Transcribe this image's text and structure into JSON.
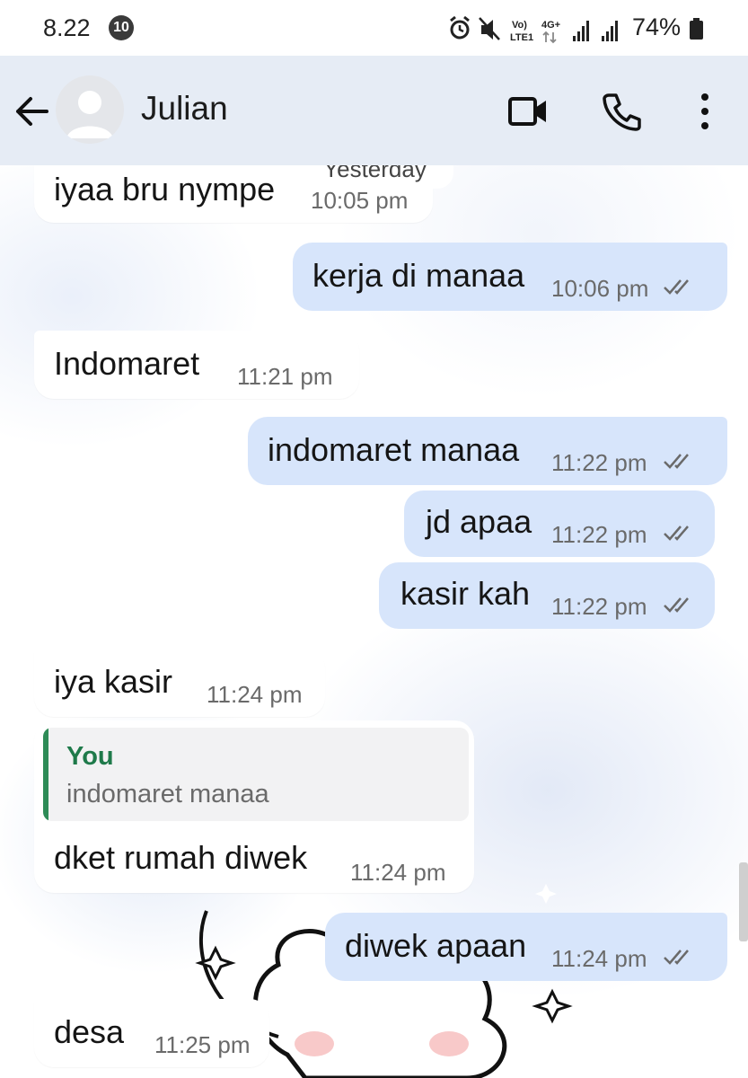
{
  "status_bar": {
    "time": "8.22",
    "notification_count": "10",
    "network_label_top": "Vo)",
    "network_label_bottom": "LTE1",
    "network_type": "4G+",
    "battery_percent": "74%",
    "icons": [
      "alarm-icon",
      "mute-icon",
      "volte-icon",
      "data-arrows-icon",
      "signal-icon",
      "signal-icon",
      "battery-icon"
    ]
  },
  "header": {
    "contact_name": "Julian",
    "icons": [
      "back-arrow-icon",
      "avatar-icon",
      "video-call-icon",
      "phone-icon",
      "more-vert-icon"
    ]
  },
  "conversation": {
    "date_chip": "Yesterday",
    "messages": [
      {
        "direction": "in",
        "text": "iyaa bru nympe",
        "time": "10:05 pm"
      },
      {
        "direction": "out",
        "text": "kerja di manaa",
        "time": "10:06 pm",
        "status": "read"
      },
      {
        "direction": "in",
        "text": "Indomaret",
        "time": "11:21 pm"
      },
      {
        "direction": "out",
        "text": "indomaret manaa",
        "time": "11:22 pm",
        "status": "read"
      },
      {
        "direction": "out",
        "text": "jd apaa",
        "time": "11:22 pm",
        "status": "read"
      },
      {
        "direction": "out",
        "text": "kasir kah",
        "time": "11:22 pm",
        "status": "read"
      },
      {
        "direction": "in",
        "text": "iya kasir",
        "time": "11:24 pm"
      },
      {
        "direction": "in",
        "text": "dket rumah diwek",
        "time": "11:24 pm",
        "quote": {
          "author": "You",
          "text": "indomaret manaa"
        }
      },
      {
        "direction": "out",
        "text": "diwek apaan",
        "time": "11:24 pm",
        "status": "read"
      },
      {
        "direction": "in",
        "text": "desa",
        "time": "11:25 pm"
      }
    ]
  },
  "colors": {
    "header_bg": "#e6ecf5",
    "outgoing_bubble": "#d7e5fb",
    "incoming_bubble": "#ffffff",
    "quote_accent": "#2e8b57"
  }
}
